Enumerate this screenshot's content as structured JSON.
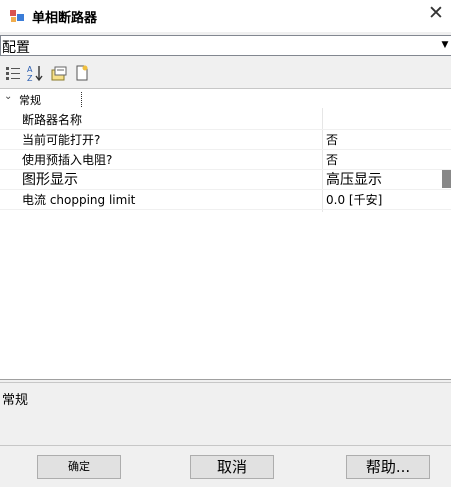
{
  "window": {
    "title": "单相断路器",
    "close_glyph": "✕",
    "icon": "component-icon"
  },
  "object_selector": {
    "value": "配置",
    "arrow_glyph": "▼"
  },
  "toolbar": {
    "buttons": [
      "categorized-view-icon",
      "sort-alphabetical-icon",
      "property-pages-icon",
      "new-page-icon"
    ]
  },
  "property_grid": {
    "category": {
      "arrow": "⌄",
      "label": "常规"
    },
    "properties": [
      {
        "name": "断路器名称",
        "value": ""
      },
      {
        "name": "当前可能打开?",
        "value": "否"
      },
      {
        "name": "使用预插入电阻?",
        "value": "否"
      },
      {
        "name": "图形显示",
        "value": "高压显示"
      },
      {
        "name": "电流 chopping limit",
        "value": "0.0 [千安]"
      }
    ]
  },
  "description": {
    "title": "常规"
  },
  "buttons": {
    "ok": "确定",
    "cancel": "取消",
    "help": "帮助..."
  }
}
